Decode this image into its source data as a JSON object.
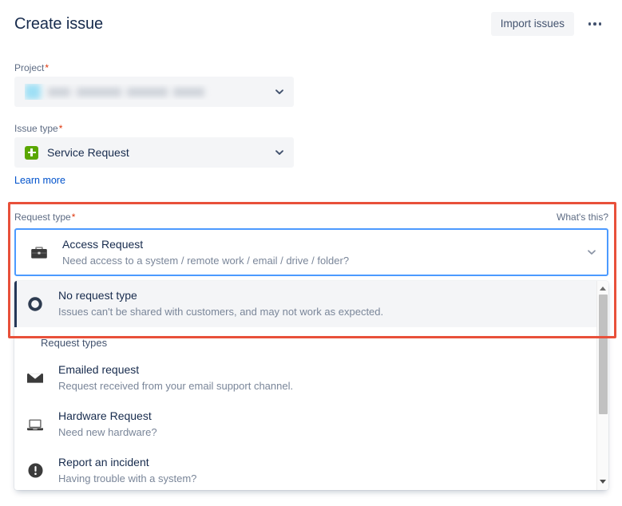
{
  "header": {
    "title": "Create issue",
    "import_label": "Import issues",
    "more_label": "More actions"
  },
  "form": {
    "project": {
      "label": "Project",
      "required_marker": "*",
      "value": "",
      "redacted": true,
      "chevron_icon": "chevron-down-icon"
    },
    "issue_type": {
      "label": "Issue type",
      "required_marker": "*",
      "value": "Service Request",
      "icon": "service-request-icon",
      "chevron_icon": "chevron-down-icon"
    },
    "learn_more": "Learn more",
    "request_type": {
      "label": "Request type",
      "required_marker": "*",
      "help_link": "What's this?",
      "selected": {
        "title": "Access Request",
        "description": "Need access to a system / remote work / email / drive / folder?",
        "icon": "briefcase-icon"
      },
      "chevron_icon": "chevron-down-icon"
    }
  },
  "dropdown": {
    "no_request_type": {
      "title": "No request type",
      "description": "Issues can't be shared with customers, and may not work as expected.",
      "icon": "ring-icon",
      "selected": true
    },
    "group_label": "Request types",
    "options": [
      {
        "title": "Emailed request",
        "description": "Request received from your email support channel.",
        "icon": "envelope-icon"
      },
      {
        "title": "Hardware Request",
        "description": "Need new hardware?",
        "icon": "laptop-icon"
      },
      {
        "title": "Report an incident",
        "description": "Having trouble with a system?",
        "icon": "exclamation-circle-icon"
      }
    ],
    "scrollbar": {
      "up_label": "Scroll up",
      "down_label": "Scroll down"
    }
  },
  "annotation": {
    "highlight_color": "#e8503a"
  },
  "colors": {
    "accent_blue": "#0052cc",
    "focus_blue": "#4c9aff",
    "required_red": "#de350b",
    "green": "#5aa700",
    "text_primary": "#172b4d",
    "text_subtle": "#5e6c84"
  }
}
